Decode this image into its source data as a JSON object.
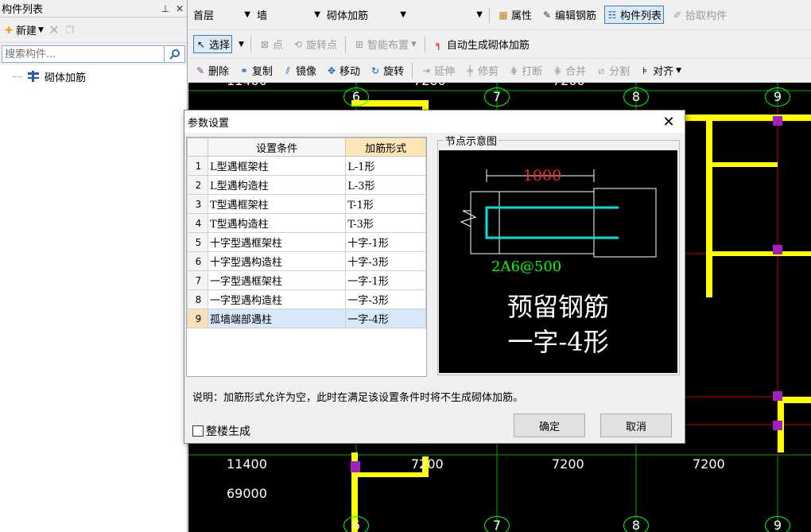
{
  "left_panel": {
    "title": "构件列表",
    "pin_icon": "pin-icon",
    "close_icon": "close-icon",
    "new_label": "新建",
    "search_placeholder": "搜索构件...",
    "tree_item": "砌体加筋"
  },
  "toolbar": {
    "floor": "首层",
    "category": "墙",
    "type": "砌体加筋",
    "property_label": "属性",
    "edit_rebar_label": "编辑钢筋",
    "component_list_label": "构件列表",
    "pick_label": "拾取构件",
    "select_label": "选择",
    "point_label": "点",
    "rotate_point_label": "旋转点",
    "smart_layout_label": "智能布置",
    "auto_gen_label": "自动生成砌体加筋",
    "delete_label": "删除",
    "copy_label": "复制",
    "mirror_label": "镜像",
    "move_label": "移动",
    "rotate_label": "旋转",
    "extend_label": "延伸",
    "trim_label": "修剪",
    "break_label": "打断",
    "merge_label": "合并",
    "split_label": "分割",
    "align_label": "对齐"
  },
  "canvas": {
    "axes_top": [
      "6",
      "7",
      "8",
      "9"
    ],
    "axes_bottom": [
      "6",
      "7",
      "8",
      "9"
    ],
    "dims_top": [
      "11400",
      "7200",
      "7200"
    ],
    "dims_bottom": [
      "11400",
      "7200",
      "7200",
      "7200"
    ],
    "total_dim": "69000"
  },
  "dialog": {
    "title": "参数设置",
    "col_condition": "设置条件",
    "col_form": "加筋形式",
    "rows": [
      {
        "idx": "1",
        "condition": "L型遇框架柱",
        "form": "L-1形"
      },
      {
        "idx": "2",
        "condition": "L型遇构造柱",
        "form": "L-3形"
      },
      {
        "idx": "3",
        "condition": "T型遇框架柱",
        "form": "T-1形"
      },
      {
        "idx": "4",
        "condition": "T型遇构造柱",
        "form": "T-3形"
      },
      {
        "idx": "5",
        "condition": "十字型遇框架柱",
        "form": "十字-1形"
      },
      {
        "idx": "6",
        "condition": "十字型遇构造柱",
        "form": "十字-3形"
      },
      {
        "idx": "7",
        "condition": "一字型遇框架柱",
        "form": "一字-1形"
      },
      {
        "idx": "8",
        "condition": "一字型遇构造柱",
        "form": "一字-3形"
      },
      {
        "idx": "9",
        "condition": "孤墙端部遇柱",
        "form": "一字-4形"
      }
    ],
    "preview_title": "节点示意图",
    "preview_dim": "1000",
    "preview_spec": "2A6@500",
    "preview_line1": "预留钢筋",
    "preview_line2": "一字-4形",
    "note": "说明：加筋形式允许为空，此时在满足该设置条件时将不生成砌体加筋。",
    "whole_building_label": "整楼生成",
    "ok_label": "确定",
    "cancel_label": "取消"
  }
}
